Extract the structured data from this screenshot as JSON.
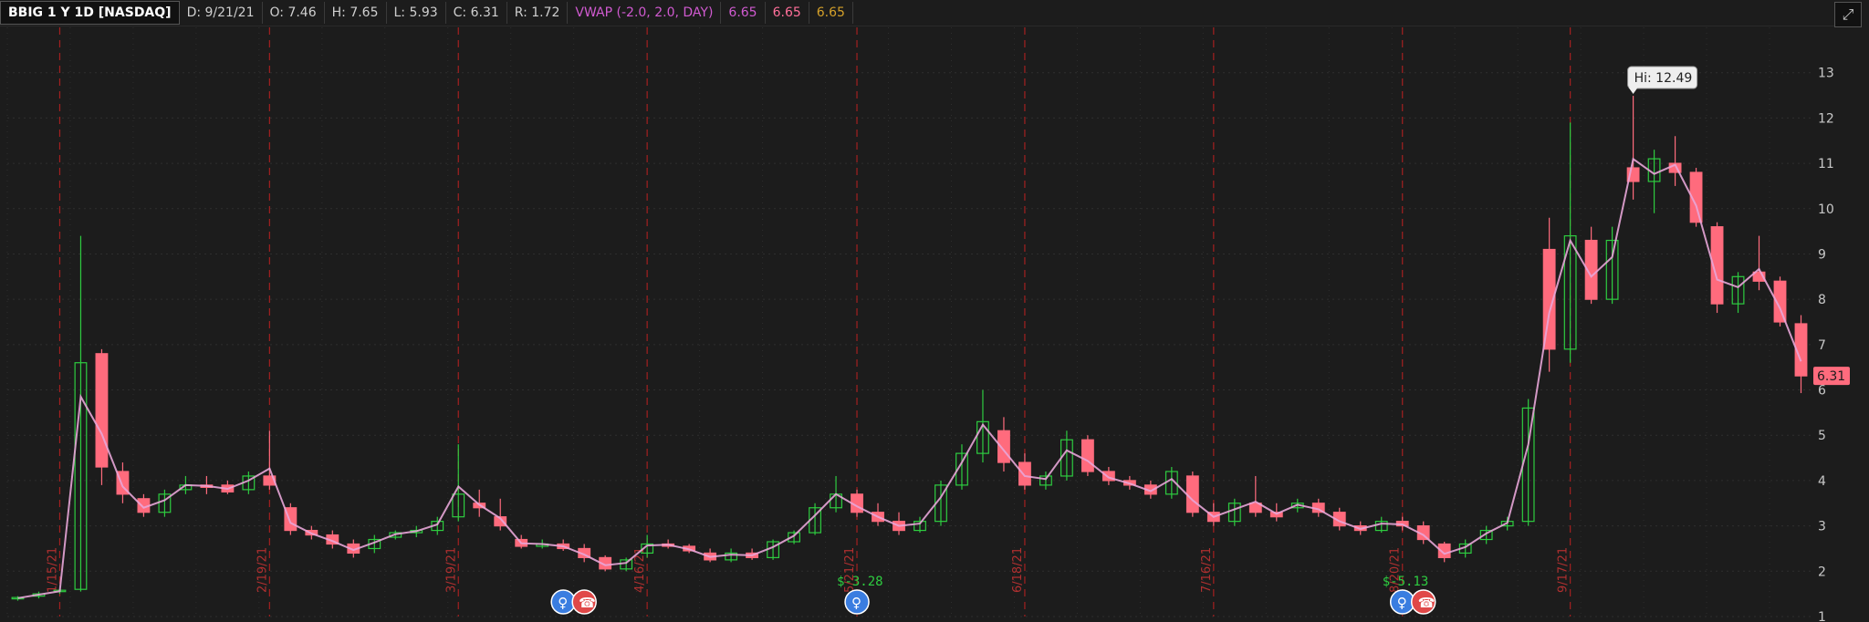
{
  "header": {
    "symbol": "BBIG 1 Y 1D [NASDAQ]",
    "date": "D: 9/21/21",
    "open": "O: 7.46",
    "high": "H: 7.65",
    "low": "L: 5.93",
    "close": "C: 6.31",
    "range": "R: 1.72",
    "vwap_label": "VWAP (-2.0, 2.0, DAY)",
    "vwap_v1": "6.65",
    "vwap_v2": "6.65",
    "vwap_v3": "6.65"
  },
  "colors": {
    "background": "#1c1c1c",
    "grid": "#2e2e2e",
    "up": "#2ecc40",
    "down": "#ff6b7d",
    "vwap_line": "#e8a6d8",
    "separator": "#a32020"
  },
  "chart_data": {
    "type": "candlestick",
    "ylim": [
      1,
      14
    ],
    "y_ticks": [
      1,
      2,
      3,
      4,
      5,
      6,
      7,
      8,
      9,
      10,
      11,
      12,
      13
    ],
    "x_labels": [
      "1/15/21",
      "2/19/21",
      "3/19/21",
      "4/16/21",
      "5/21/21",
      "6/18/21",
      "7/16/21",
      "8/20/21",
      "9/17/21"
    ],
    "separators": [
      2,
      12,
      21,
      30,
      40,
      48,
      57,
      66,
      74
    ],
    "hi_label": "Hi: 12.49",
    "last_price": "6.31",
    "annotations": [
      {
        "text": "$-3.28",
        "x": 40
      },
      {
        "text": "$-5.13",
        "x": 66
      }
    ],
    "event_icons": [
      {
        "x": 26,
        "kind": "bulb-icon",
        "color": "#3a7de0"
      },
      {
        "x": 27,
        "kind": "phone-icon",
        "color": "#e04848"
      },
      {
        "x": 40,
        "kind": "bulb-icon",
        "color": "#3a7de0"
      },
      {
        "x": 66,
        "kind": "bulb-icon",
        "color": "#3a7de0"
      },
      {
        "x": 67,
        "kind": "phone-icon",
        "color": "#e04848"
      }
    ],
    "candles": [
      [
        1.4,
        1.45,
        1.35,
        1.42
      ],
      [
        1.45,
        1.55,
        1.4,
        1.5
      ],
      [
        1.55,
        1.6,
        1.5,
        1.58
      ],
      [
        1.6,
        9.4,
        1.55,
        6.6
      ],
      [
        6.8,
        6.9,
        3.9,
        4.3
      ],
      [
        4.2,
        4.4,
        3.5,
        3.7
      ],
      [
        3.6,
        3.7,
        3.2,
        3.3
      ],
      [
        3.3,
        3.8,
        3.2,
        3.7
      ],
      [
        3.8,
        4.1,
        3.7,
        3.9
      ],
      [
        3.9,
        4.1,
        3.7,
        3.85
      ],
      [
        3.9,
        4.0,
        3.7,
        3.75
      ],
      [
        3.8,
        4.2,
        3.7,
        4.1
      ],
      [
        4.1,
        5.1,
        3.8,
        3.9
      ],
      [
        3.4,
        3.5,
        2.8,
        2.9
      ],
      [
        2.9,
        3.0,
        2.7,
        2.8
      ],
      [
        2.8,
        2.9,
        2.5,
        2.6
      ],
      [
        2.6,
        2.7,
        2.3,
        2.4
      ],
      [
        2.5,
        2.8,
        2.4,
        2.7
      ],
      [
        2.75,
        2.9,
        2.7,
        2.85
      ],
      [
        2.85,
        3.0,
        2.75,
        2.9
      ],
      [
        2.9,
        3.2,
        2.8,
        3.1
      ],
      [
        3.2,
        4.8,
        3.1,
        3.7
      ],
      [
        3.5,
        3.8,
        3.2,
        3.4
      ],
      [
        3.2,
        3.6,
        2.9,
        3.0
      ],
      [
        2.7,
        2.8,
        2.5,
        2.55
      ],
      [
        2.55,
        2.7,
        2.5,
        2.6
      ],
      [
        2.6,
        2.7,
        2.45,
        2.5
      ],
      [
        2.5,
        2.6,
        2.2,
        2.3
      ],
      [
        2.3,
        2.35,
        2.0,
        2.05
      ],
      [
        2.05,
        2.3,
        2.0,
        2.25
      ],
      [
        2.4,
        2.8,
        2.3,
        2.6
      ],
      [
        2.6,
        2.7,
        2.5,
        2.55
      ],
      [
        2.55,
        2.6,
        2.4,
        2.45
      ],
      [
        2.4,
        2.5,
        2.2,
        2.25
      ],
      [
        2.25,
        2.5,
        2.2,
        2.4
      ],
      [
        2.4,
        2.5,
        2.25,
        2.3
      ],
      [
        2.3,
        2.7,
        2.25,
        2.65
      ],
      [
        2.65,
        2.9,
        2.6,
        2.85
      ],
      [
        2.85,
        3.5,
        2.8,
        3.4
      ],
      [
        3.4,
        4.1,
        3.3,
        3.7
      ],
      [
        3.7,
        3.8,
        3.2,
        3.3
      ],
      [
        3.3,
        3.5,
        3.0,
        3.1
      ],
      [
        3.1,
        3.3,
        2.8,
        2.9
      ],
      [
        2.9,
        3.2,
        2.85,
        3.1
      ],
      [
        3.1,
        4.0,
        3.0,
        3.9
      ],
      [
        3.9,
        4.8,
        3.8,
        4.6
      ],
      [
        4.6,
        6.0,
        4.4,
        5.3
      ],
      [
        5.1,
        5.4,
        4.2,
        4.4
      ],
      [
        4.4,
        4.6,
        3.8,
        3.9
      ],
      [
        3.9,
        4.2,
        3.8,
        4.1
      ],
      [
        4.1,
        5.1,
        4.0,
        4.9
      ],
      [
        4.9,
        5.0,
        4.1,
        4.2
      ],
      [
        4.2,
        4.3,
        3.9,
        4.0
      ],
      [
        4.0,
        4.1,
        3.8,
        3.9
      ],
      [
        3.9,
        4.0,
        3.6,
        3.7
      ],
      [
        3.7,
        4.3,
        3.6,
        4.2
      ],
      [
        4.1,
        4.2,
        3.2,
        3.3
      ],
      [
        3.3,
        3.5,
        3.0,
        3.1
      ],
      [
        3.1,
        3.6,
        3.0,
        3.5
      ],
      [
        3.5,
        4.1,
        3.2,
        3.3
      ],
      [
        3.3,
        3.5,
        3.1,
        3.2
      ],
      [
        3.4,
        3.6,
        3.3,
        3.5
      ],
      [
        3.5,
        3.6,
        3.2,
        3.3
      ],
      [
        3.3,
        3.4,
        2.9,
        3.0
      ],
      [
        3.0,
        3.1,
        2.8,
        2.9
      ],
      [
        2.9,
        3.2,
        2.85,
        3.1
      ],
      [
        3.1,
        3.2,
        2.9,
        3.0
      ],
      [
        3.0,
        3.1,
        2.6,
        2.7
      ],
      [
        2.6,
        2.65,
        2.2,
        2.3
      ],
      [
        2.4,
        2.7,
        2.3,
        2.6
      ],
      [
        2.7,
        3.0,
        2.6,
        2.9
      ],
      [
        3.0,
        3.2,
        2.9,
        3.1
      ],
      [
        3.1,
        5.8,
        3.0,
        5.6
      ],
      [
        9.1,
        9.8,
        6.4,
        6.9
      ],
      [
        6.9,
        11.9,
        6.6,
        9.4
      ],
      [
        9.3,
        9.6,
        7.9,
        8.0
      ],
      [
        8.0,
        9.6,
        7.9,
        9.3
      ],
      [
        10.9,
        12.49,
        10.2,
        10.6
      ],
      [
        10.6,
        11.3,
        9.9,
        11.1
      ],
      [
        11.0,
        11.6,
        10.5,
        10.8
      ],
      [
        10.8,
        10.9,
        9.6,
        9.7
      ],
      [
        9.6,
        9.7,
        7.7,
        7.9
      ],
      [
        7.9,
        8.6,
        7.7,
        8.5
      ],
      [
        8.6,
        9.4,
        8.2,
        8.4
      ],
      [
        8.4,
        8.5,
        7.4,
        7.5
      ],
      [
        7.46,
        7.65,
        5.93,
        6.31
      ]
    ]
  }
}
